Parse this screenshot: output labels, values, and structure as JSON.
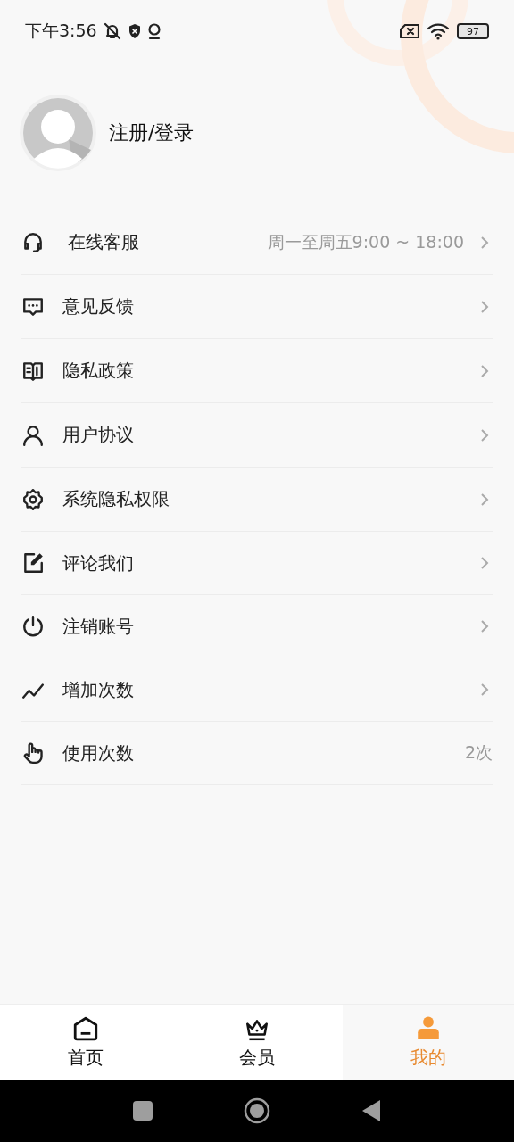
{
  "status_bar": {
    "time": "下午3:56",
    "battery": "97"
  },
  "profile": {
    "login": "注册/登录"
  },
  "menu": [
    {
      "label": "在线客服",
      "value": "周一至周五9:00 ~ 18:00",
      "chevron": true
    },
    {
      "label": "意见反馈",
      "chevron": true
    },
    {
      "label": "隐私政策",
      "chevron": true
    },
    {
      "label": "用户协议",
      "chevron": true
    },
    {
      "label": "系统隐私权限",
      "chevron": true
    },
    {
      "label": "评论我们",
      "chevron": true
    },
    {
      "label": "注销账号",
      "chevron": true
    },
    {
      "label": "增加次数",
      "chevron": true
    },
    {
      "label": "使用次数",
      "value": "2次",
      "chevron": false
    }
  ],
  "tabs": [
    {
      "label": "首页",
      "selected": false
    },
    {
      "label": "会员",
      "selected": false
    },
    {
      "label": "我的",
      "selected": true
    }
  ]
}
